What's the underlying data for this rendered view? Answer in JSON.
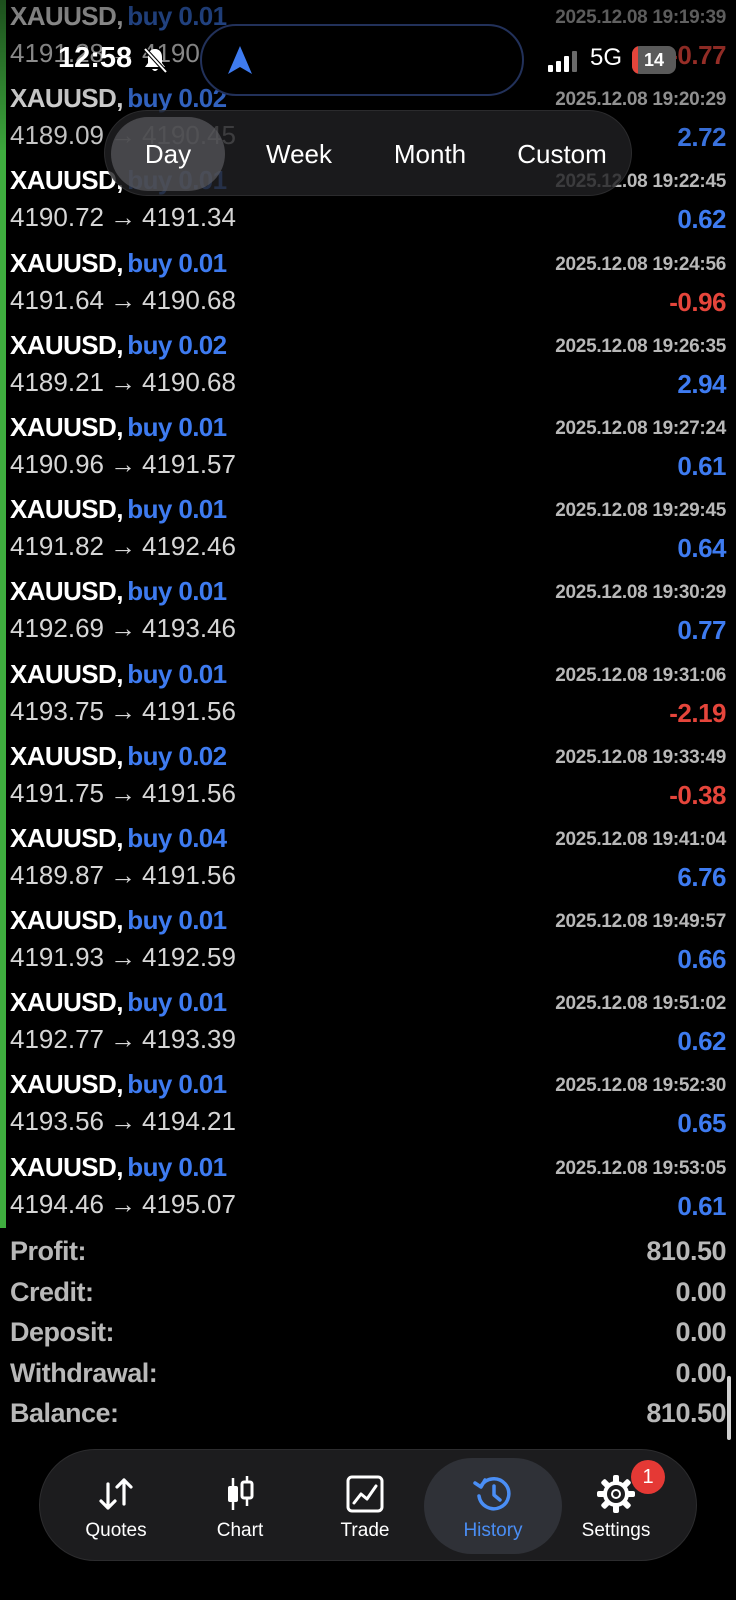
{
  "status_bar": {
    "time": "12:58",
    "network": "5G",
    "battery_level": "14",
    "battery_fraction": 0.14
  },
  "period_selector": {
    "tabs": [
      {
        "label": "Day",
        "active": true
      },
      {
        "label": "Week",
        "active": false
      },
      {
        "label": "Month",
        "active": false
      },
      {
        "label": "Custom",
        "active": false
      }
    ]
  },
  "trades": [
    {
      "symbol": "XAUUSD,",
      "side": "buy 0.01",
      "time": "2025.12.08 19:19:39",
      "open": "4191.28",
      "close": "4190.51",
      "arrow": "→",
      "profit": "-0.77",
      "sign": "neg"
    },
    {
      "symbol": "XAUUSD,",
      "side": "buy 0.02",
      "time": "2025.12.08 19:20:29",
      "open": "4189.09",
      "close": "4190.45",
      "arrow": "→",
      "profit": "2.72",
      "sign": "pos"
    },
    {
      "symbol": "XAUUSD,",
      "side": "buy 0.01",
      "time": "2025.12.08 19:22:45",
      "open": "4190.72",
      "close": "4191.34",
      "arrow": "→",
      "profit": "0.62",
      "sign": "pos"
    },
    {
      "symbol": "XAUUSD,",
      "side": "buy 0.01",
      "time": "2025.12.08 19:24:56",
      "open": "4191.64",
      "close": "4190.68",
      "arrow": "→",
      "profit": "-0.96",
      "sign": "neg"
    },
    {
      "symbol": "XAUUSD,",
      "side": "buy 0.02",
      "time": "2025.12.08 19:26:35",
      "open": "4189.21",
      "close": "4190.68",
      "arrow": "→",
      "profit": "2.94",
      "sign": "pos"
    },
    {
      "symbol": "XAUUSD,",
      "side": "buy 0.01",
      "time": "2025.12.08 19:27:24",
      "open": "4190.96",
      "close": "4191.57",
      "arrow": "→",
      "profit": "0.61",
      "sign": "pos"
    },
    {
      "symbol": "XAUUSD,",
      "side": "buy 0.01",
      "time": "2025.12.08 19:29:45",
      "open": "4191.82",
      "close": "4192.46",
      "arrow": "→",
      "profit": "0.64",
      "sign": "pos"
    },
    {
      "symbol": "XAUUSD,",
      "side": "buy 0.01",
      "time": "2025.12.08 19:30:29",
      "open": "4192.69",
      "close": "4193.46",
      "arrow": "→",
      "profit": "0.77",
      "sign": "pos"
    },
    {
      "symbol": "XAUUSD,",
      "side": "buy 0.01",
      "time": "2025.12.08 19:31:06",
      "open": "4193.75",
      "close": "4191.56",
      "arrow": "→",
      "profit": "-2.19",
      "sign": "neg"
    },
    {
      "symbol": "XAUUSD,",
      "side": "buy 0.02",
      "time": "2025.12.08 19:33:49",
      "open": "4191.75",
      "close": "4191.56",
      "arrow": "→",
      "profit": "-0.38",
      "sign": "neg"
    },
    {
      "symbol": "XAUUSD,",
      "side": "buy 0.04",
      "time": "2025.12.08 19:41:04",
      "open": "4189.87",
      "close": "4191.56",
      "arrow": "→",
      "profit": "6.76",
      "sign": "pos"
    },
    {
      "symbol": "XAUUSD,",
      "side": "buy 0.01",
      "time": "2025.12.08 19:49:57",
      "open": "4191.93",
      "close": "4192.59",
      "arrow": "→",
      "profit": "0.66",
      "sign": "pos"
    },
    {
      "symbol": "XAUUSD,",
      "side": "buy 0.01",
      "time": "2025.12.08 19:51:02",
      "open": "4192.77",
      "close": "4193.39",
      "arrow": "→",
      "profit": "0.62",
      "sign": "pos"
    },
    {
      "symbol": "XAUUSD,",
      "side": "buy 0.01",
      "time": "2025.12.08 19:52:30",
      "open": "4193.56",
      "close": "4194.21",
      "arrow": "→",
      "profit": "0.65",
      "sign": "pos"
    },
    {
      "symbol": "XAUUSD,",
      "side": "buy 0.01",
      "time": "2025.12.08 19:53:05",
      "open": "4194.46",
      "close": "4195.07",
      "arrow": "→",
      "profit": "0.61",
      "sign": "pos"
    }
  ],
  "summary": [
    {
      "label": "Profit:",
      "value": "810.50"
    },
    {
      "label": "Credit:",
      "value": "0.00"
    },
    {
      "label": "Deposit:",
      "value": "0.00"
    },
    {
      "label": "Withdrawal:",
      "value": "0.00"
    },
    {
      "label": "Balance:",
      "value": "810.50"
    }
  ],
  "tab_bar": {
    "items": [
      {
        "label": "Quotes",
        "icon": "quotes-arrows-icon",
        "active": false
      },
      {
        "label": "Chart",
        "icon": "candlestick-icon",
        "active": false
      },
      {
        "label": "Trade",
        "icon": "trade-chart-icon",
        "active": false
      },
      {
        "label": "History",
        "icon": "history-clock-icon",
        "active": true
      },
      {
        "label": "Settings",
        "icon": "gear-icon",
        "active": false,
        "badge": "1"
      }
    ]
  },
  "colors": {
    "accent_green": "#3fae3f",
    "buy_blue": "#3e7bf0",
    "loss_red": "#e5453b",
    "active_tab_blue": "#4a8ef5",
    "badge_red": "#e53935"
  }
}
